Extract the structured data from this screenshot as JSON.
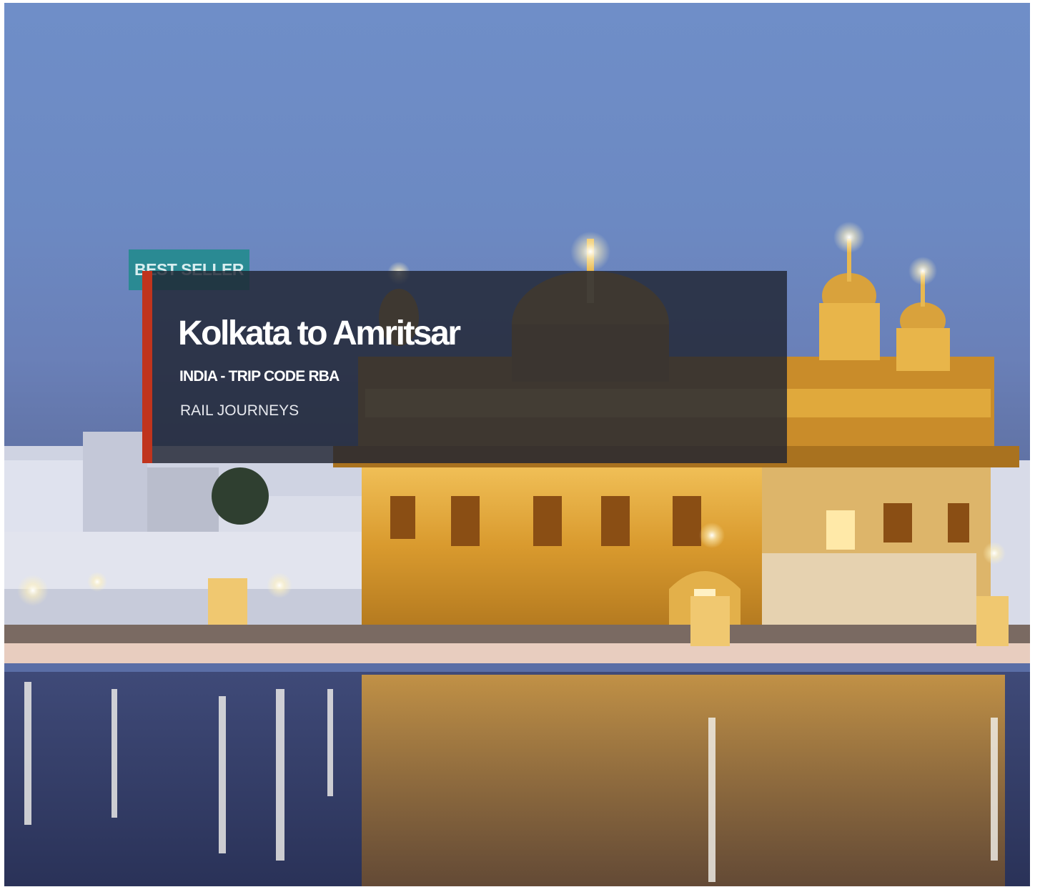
{
  "tour_card": {
    "badge_label": "BEST SELLER",
    "title": "Kolkata to Amritsar",
    "subtitle": "INDIA - TRIP CODE RBA",
    "category": "RAIL JOURNEYS",
    "colors": {
      "badge_background": "#2a8a93",
      "accent_stripe": "#c0341d",
      "overlay": "#202432"
    }
  }
}
